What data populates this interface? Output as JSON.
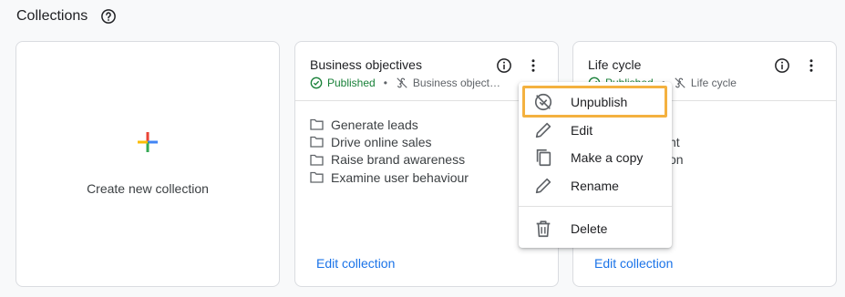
{
  "header": {
    "title": "Collections",
    "help_icon": "help-circle-icon"
  },
  "create_card": {
    "label": "Create new collection",
    "icon": "plus-icon",
    "colors": [
      "#4285f4",
      "#ea4335",
      "#fbbc04",
      "#34a853"
    ]
  },
  "collections": [
    {
      "title": "Business objectives",
      "status": "Published",
      "type": "Business object…",
      "items": [
        "Generate leads",
        "Drive online sales",
        "Raise brand awareness",
        "Examine user behaviour"
      ],
      "edit_label": "Edit collection"
    },
    {
      "title": "Life cycle",
      "status": "Published",
      "type": "Life cycle",
      "items": [
        "",
        "",
        "Engagement",
        "Retention"
      ],
      "visible_fragments": [
        "nt",
        "on"
      ],
      "edit_label": "Edit collection"
    }
  ],
  "menu": {
    "items": [
      {
        "label": "Unpublish",
        "icon": "unpublish-icon"
      },
      {
        "label": "Edit",
        "icon": "pencil-icon"
      },
      {
        "label": "Make a copy",
        "icon": "copy-icon"
      },
      {
        "label": "Rename",
        "icon": "pencil-icon"
      },
      {
        "label": "Delete",
        "icon": "trash-icon"
      }
    ],
    "highlighted": "Unpublish",
    "highlight_color": "#f4b13f"
  },
  "colors": {
    "published": "#188038",
    "link": "#1a73e8"
  }
}
